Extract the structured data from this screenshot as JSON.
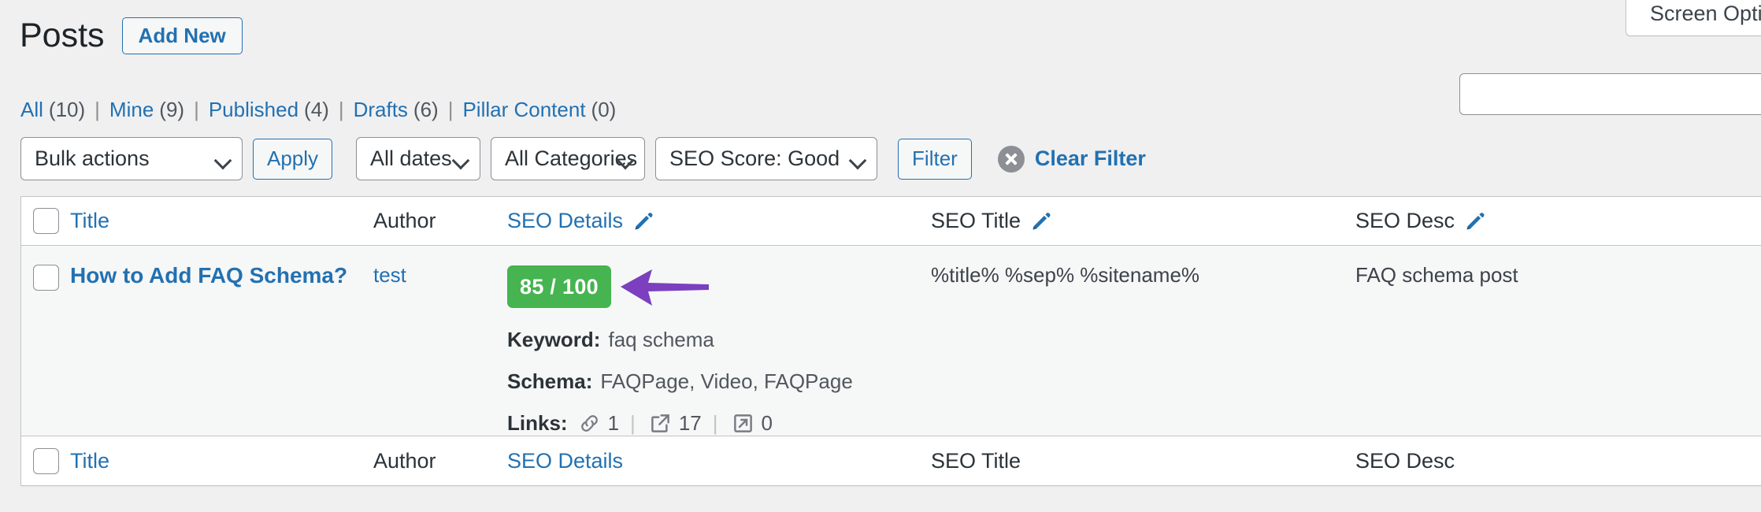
{
  "screen_options": {
    "label": "Screen Options"
  },
  "header": {
    "title": "Posts",
    "add_new_label": "Add New"
  },
  "search": {
    "value": "",
    "placeholder": ""
  },
  "status_links": [
    {
      "label": "All",
      "count": "(10)"
    },
    {
      "label": "Mine",
      "count": "(9)"
    },
    {
      "label": "Published",
      "count": "(4)"
    },
    {
      "label": "Drafts",
      "count": "(6)"
    },
    {
      "label": "Pillar Content",
      "count": "(0)"
    }
  ],
  "separator": "|",
  "toolbar": {
    "bulk_actions": "Bulk actions",
    "apply_label": "Apply",
    "all_dates": "All dates",
    "all_categories": "All Categories",
    "seo_score": "SEO Score: Good",
    "filter_label": "Filter",
    "clear_filter_label": "Clear Filter"
  },
  "colors": {
    "accent_link": "#2271b1",
    "score_green": "#46b450",
    "arrow_purple": "#7b3fbf",
    "pencil_blue": "#2271b1"
  },
  "table": {
    "columns_head": [
      {
        "label": "Title",
        "link": true,
        "pencil": false
      },
      {
        "label": "Author",
        "link": false,
        "pencil": false
      },
      {
        "label": "SEO Details",
        "link": true,
        "pencil": true
      },
      {
        "label": "SEO Title",
        "link": false,
        "pencil": true
      },
      {
        "label": "SEO Desc",
        "link": false,
        "pencil": true
      }
    ],
    "columns_foot": [
      {
        "label": "Title",
        "link": true
      },
      {
        "label": "Author",
        "link": false
      },
      {
        "label": "SEO Details",
        "link": true
      },
      {
        "label": "SEO Title",
        "link": false
      },
      {
        "label": "SEO Desc",
        "link": false
      }
    ],
    "rows": [
      {
        "title": "How to Add FAQ Schema?",
        "author": "test",
        "score": "85 / 100",
        "keyword_label": "Keyword:",
        "keyword_value": "faq schema",
        "schema_label": "Schema:",
        "schema_value": "FAQPage, Video, FAQPage",
        "links_label": "Links:",
        "links_internal": "1",
        "links_external": "17",
        "links_other": "0",
        "seo_title": "%title% %sep% %sitename%",
        "seo_desc": "FAQ schema post"
      }
    ]
  }
}
